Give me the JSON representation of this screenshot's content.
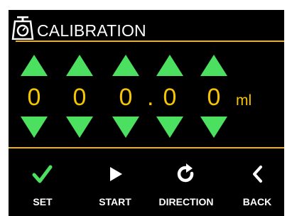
{
  "header": {
    "title": "CALIBRATION",
    "icon": "scale-icon"
  },
  "colors": {
    "background": "#000000",
    "accent": "#f0b400",
    "digits": "#f6c400",
    "arrows": "#4ce060",
    "text": "#ffffff"
  },
  "volume": {
    "digits": [
      "0",
      "0",
      "0",
      "0",
      "0"
    ],
    "decimal_point": ".",
    "unit": "ml"
  },
  "buttons": {
    "set": {
      "label": "SET",
      "icon": "checkmark-icon"
    },
    "start": {
      "label": "START",
      "icon": "play-icon"
    },
    "direction": {
      "label": "DIRECTION",
      "icon": "rotate-icon"
    },
    "back": {
      "label": "BACK",
      "icon": "chevron-left-icon"
    }
  }
}
